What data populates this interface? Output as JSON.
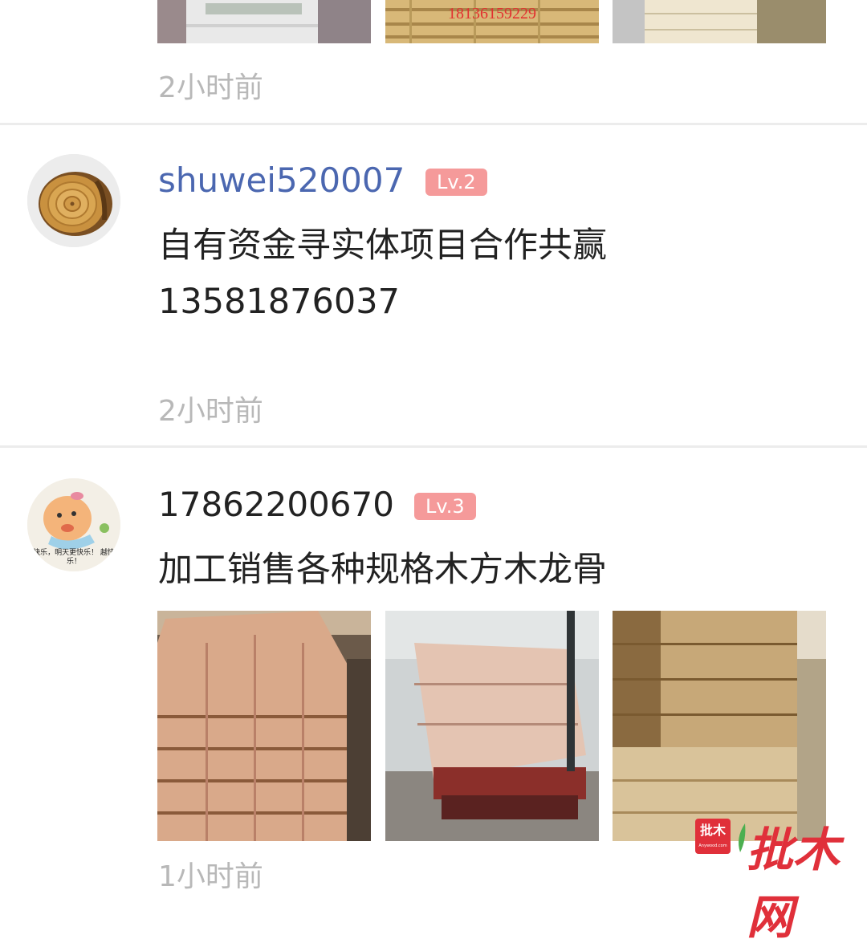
{
  "post_top": {
    "photo_overlay_phone": "18136159229",
    "time": "2小时前"
  },
  "post_1": {
    "username": "shuwei520007",
    "level": "Lv.2",
    "content_line1": "自有资金寻实体项目合作共赢",
    "content_line2": "13581876037",
    "time": "2小时前"
  },
  "post_2": {
    "username": "17862200670",
    "level": "Lv.3",
    "content": "加工销售各种规格木方木龙骨",
    "avatar_caption": "快乐，明天更快乐！ 越快乐！",
    "time": "1小时前"
  },
  "watermark": {
    "badge_text": "批木",
    "site_text": "批木网",
    "badge_small": "Anywood.com"
  }
}
